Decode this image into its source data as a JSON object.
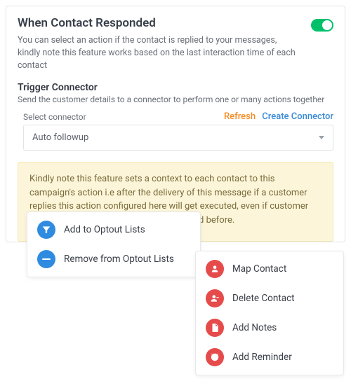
{
  "card": {
    "title": "When Contact Responded",
    "desc": "You can select an action if the contact is replied to your messages, kindly note this feature works based on the last interaction time of each contact",
    "toggle_on": true
  },
  "connector": {
    "title": "Trigger Connector",
    "desc": "Send the customer details to a connector to perform one or many actions together",
    "select_label": "Select connector",
    "refresh_label": "Refresh",
    "create_label": "Create Connector",
    "selected": "Auto followup"
  },
  "notice": "Kindly note this feature sets a context to each contact to this campaign's action i.e after the delivery of this message if a customer replies this action configured here will get executed, even if customer tagging reply to another message you send before.",
  "menu_left": [
    {
      "label": "Add to Optout Lists"
    },
    {
      "label": "Remove from Optout Lists"
    }
  ],
  "menu_right": [
    {
      "label": "Map Contact"
    },
    {
      "label": "Delete Contact"
    },
    {
      "label": "Add Notes"
    },
    {
      "label": "Add Reminder"
    }
  ]
}
